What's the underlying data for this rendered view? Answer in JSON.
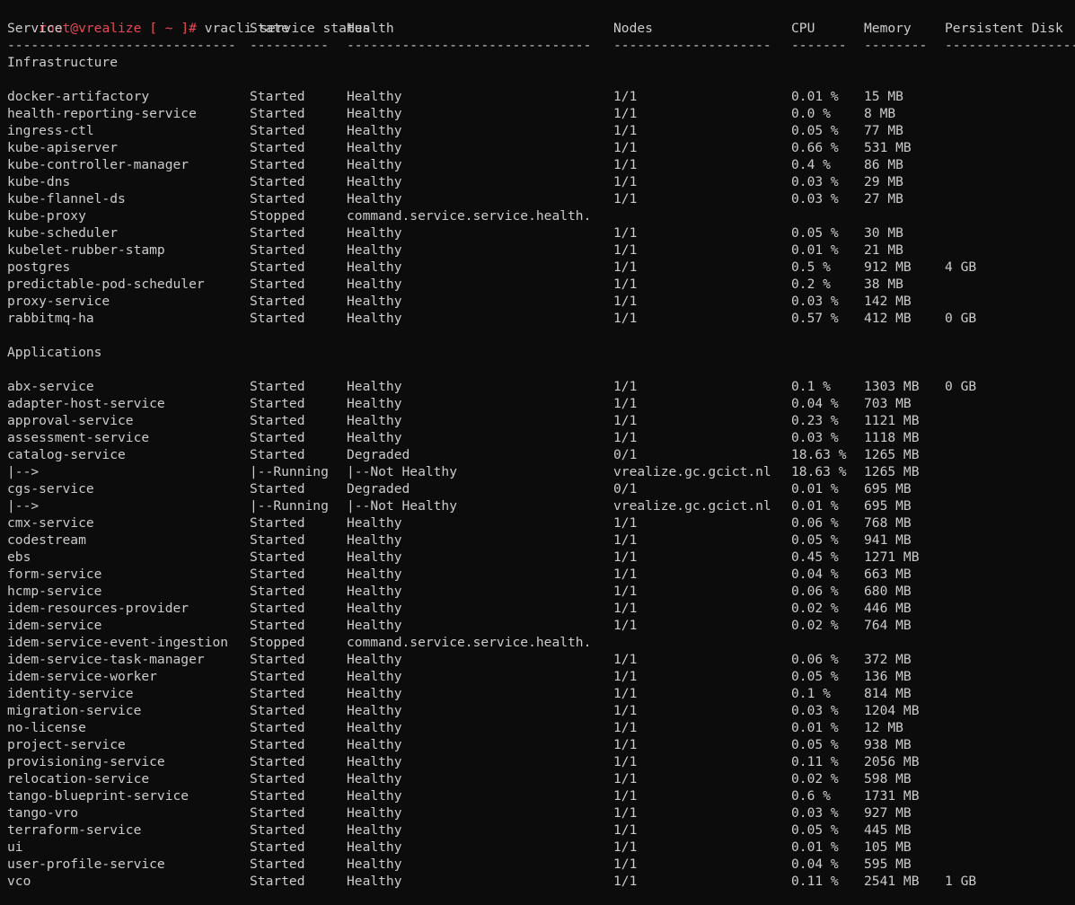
{
  "prompt": {
    "user_host": "root@vrealize",
    "dir": "[ ~ ]#",
    "command": "vracli service status"
  },
  "columns": [
    "Service",
    "State",
    "Health",
    "Nodes",
    "CPU",
    "Memory",
    "Persistent Disk"
  ],
  "separators": [
    "-----------------------------",
    "----------",
    "-------------------------------",
    "--------------------",
    "-------",
    "--------",
    "-----------------"
  ],
  "sections": [
    {
      "title": "Infrastructure",
      "rows": [
        [
          "docker-artifactory",
          "Started",
          "Healthy",
          "1/1",
          "0.01 %",
          "15 MB",
          ""
        ],
        [
          "health-reporting-service",
          "Started",
          "Healthy",
          "1/1",
          "0.0 %",
          "8 MB",
          ""
        ],
        [
          "ingress-ctl",
          "Started",
          "Healthy",
          "1/1",
          "0.05 %",
          "77 MB",
          ""
        ],
        [
          "kube-apiserver",
          "Started",
          "Healthy",
          "1/1",
          "0.66 %",
          "531 MB",
          ""
        ],
        [
          "kube-controller-manager",
          "Started",
          "Healthy",
          "1/1",
          "0.4 %",
          "86 MB",
          ""
        ],
        [
          "kube-dns",
          "Started",
          "Healthy",
          "1/1",
          "0.03 %",
          "29 MB",
          ""
        ],
        [
          "kube-flannel-ds",
          "Started",
          "Healthy",
          "1/1",
          "0.03 %",
          "27 MB",
          ""
        ],
        [
          "kube-proxy",
          "Stopped",
          "command.service.service.health.",
          "",
          "",
          "",
          ""
        ],
        [
          "kube-scheduler",
          "Started",
          "Healthy",
          "1/1",
          "0.05 %",
          "30 MB",
          ""
        ],
        [
          "kubelet-rubber-stamp",
          "Started",
          "Healthy",
          "1/1",
          "0.01 %",
          "21 MB",
          ""
        ],
        [
          "postgres",
          "Started",
          "Healthy",
          "1/1",
          "0.5 %",
          "912 MB",
          "4 GB"
        ],
        [
          "predictable-pod-scheduler",
          "Started",
          "Healthy",
          "1/1",
          "0.2 %",
          "38 MB",
          ""
        ],
        [
          "proxy-service",
          "Started",
          "Healthy",
          "1/1",
          "0.03 %",
          "142 MB",
          ""
        ],
        [
          "rabbitmq-ha",
          "Started",
          "Healthy",
          "1/1",
          "0.57 %",
          "412 MB",
          "0 GB"
        ]
      ]
    },
    {
      "title": "Applications",
      "rows": [
        [
          "abx-service",
          "Started",
          "Healthy",
          "1/1",
          "0.1 %",
          "1303 MB",
          "0 GB"
        ],
        [
          "adapter-host-service",
          "Started",
          "Healthy",
          "1/1",
          "0.04 %",
          "703 MB",
          ""
        ],
        [
          "approval-service",
          "Started",
          "Healthy",
          "1/1",
          "0.23 %",
          "1121 MB",
          ""
        ],
        [
          "assessment-service",
          "Started",
          "Healthy",
          "1/1",
          "0.03 %",
          "1118 MB",
          ""
        ],
        [
          "catalog-service",
          "Started",
          "Degraded",
          "0/1",
          "18.63 %",
          "1265 MB",
          ""
        ],
        [
          "|-->",
          "|--Running",
          "|--Not Healthy",
          "vrealize.gc.gcict.nl",
          "18.63 %",
          "1265 MB",
          ""
        ],
        [
          "cgs-service",
          "Started",
          "Degraded",
          "0/1",
          "0.01 %",
          "695 MB",
          ""
        ],
        [
          "|-->",
          "|--Running",
          "|--Not Healthy",
          "vrealize.gc.gcict.nl",
          "0.01 %",
          "695 MB",
          ""
        ],
        [
          "cmx-service",
          "Started",
          "Healthy",
          "1/1",
          "0.06 %",
          "768 MB",
          ""
        ],
        [
          "codestream",
          "Started",
          "Healthy",
          "1/1",
          "0.05 %",
          "941 MB",
          ""
        ],
        [
          "ebs",
          "Started",
          "Healthy",
          "1/1",
          "0.45 %",
          "1271 MB",
          ""
        ],
        [
          "form-service",
          "Started",
          "Healthy",
          "1/1",
          "0.04 %",
          "663 MB",
          ""
        ],
        [
          "hcmp-service",
          "Started",
          "Healthy",
          "1/1",
          "0.06 %",
          "680 MB",
          ""
        ],
        [
          "idem-resources-provider",
          "Started",
          "Healthy",
          "1/1",
          "0.02 %",
          "446 MB",
          ""
        ],
        [
          "idem-service",
          "Started",
          "Healthy",
          "1/1",
          "0.02 %",
          "764 MB",
          ""
        ],
        [
          "idem-service-event-ingestion",
          "Stopped",
          "command.service.service.health.",
          "",
          "",
          "",
          ""
        ],
        [
          "idem-service-task-manager",
          "Started",
          "Healthy",
          "1/1",
          "0.06 %",
          "372 MB",
          ""
        ],
        [
          "idem-service-worker",
          "Started",
          "Healthy",
          "1/1",
          "0.05 %",
          "136 MB",
          ""
        ],
        [
          "identity-service",
          "Started",
          "Healthy",
          "1/1",
          "0.1 %",
          "814 MB",
          ""
        ],
        [
          "migration-service",
          "Started",
          "Healthy",
          "1/1",
          "0.03 %",
          "1204 MB",
          ""
        ],
        [
          "no-license",
          "Started",
          "Healthy",
          "1/1",
          "0.01 %",
          "12 MB",
          ""
        ],
        [
          "project-service",
          "Started",
          "Healthy",
          "1/1",
          "0.05 %",
          "938 MB",
          ""
        ],
        [
          "provisioning-service",
          "Started",
          "Healthy",
          "1/1",
          "0.11 %",
          "2056 MB",
          ""
        ],
        [
          "relocation-service",
          "Started",
          "Healthy",
          "1/1",
          "0.02 %",
          "598 MB",
          ""
        ],
        [
          "tango-blueprint-service",
          "Started",
          "Healthy",
          "1/1",
          "0.6 %",
          "1731 MB",
          ""
        ],
        [
          "tango-vro",
          "Started",
          "Healthy",
          "1/1",
          "0.03 %",
          "927 MB",
          ""
        ],
        [
          "terraform-service",
          "Started",
          "Healthy",
          "1/1",
          "0.05 %",
          "445 MB",
          ""
        ],
        [
          "ui",
          "Started",
          "Healthy",
          "1/1",
          "0.01 %",
          "105 MB",
          ""
        ],
        [
          "user-profile-service",
          "Started",
          "Healthy",
          "1/1",
          "0.04 %",
          "595 MB",
          ""
        ],
        [
          "vco",
          "Started",
          "Healthy",
          "1/1",
          "0.11 %",
          "2541 MB",
          "1 GB"
        ]
      ]
    }
  ],
  "colors": {
    "background": "#0c0c0c",
    "text": "#cccccc",
    "prompt_user": "#e74856"
  }
}
